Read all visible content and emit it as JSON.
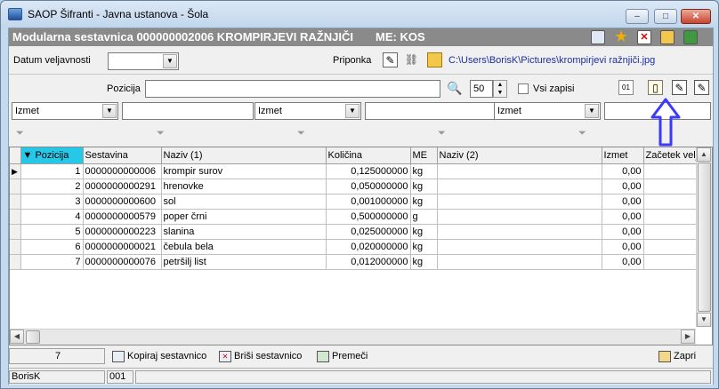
{
  "window": {
    "title": "SAOP Šifranti  - Javna ustanova - Šola",
    "buttons": {
      "minimize": "–",
      "maximize": "□",
      "close": "✕"
    }
  },
  "header": {
    "title": "Modularna sestavnica 000000002006 KROMPIRJEVI RAŽNJIČI",
    "me": "ME: KOS",
    "icons": [
      "list-icon",
      "star-icon",
      "delete-icon",
      "folder-save-icon",
      "export-icon"
    ]
  },
  "form": {
    "datum_label": "Datum veljavnosti",
    "datum_value": "",
    "priponka_label": "Priponka",
    "priponka_path": "C:\\Users\\BorisK\\Pictures\\krompirjevi ražnjiči.jpg",
    "pozicija_label": "Pozicija",
    "pozicija_value": "",
    "count_value": "50",
    "vsi_zapisi_label": "Vsi zapisi",
    "filters": [
      {
        "select": "Izmet",
        "text": ""
      },
      {
        "select": "Izmet",
        "text": ""
      },
      {
        "select": "Izmet",
        "text": ""
      }
    ]
  },
  "grid": {
    "columns": [
      "Pozicija",
      "Sestavina",
      "Naziv (1)",
      "Količina",
      "ME",
      "Naziv (2)",
      "Izmet",
      "Začetek velj"
    ],
    "rows": [
      {
        "pozicija": "1",
        "sestavina": "0000000000006",
        "naziv1": "krompir surov",
        "kolicina": "0,125000000",
        "me": "kg",
        "naziv2": "",
        "izmet": "0,00",
        "zacetek": ""
      },
      {
        "pozicija": "2",
        "sestavina": "0000000000291",
        "naziv1": "hrenovke",
        "kolicina": "0,050000000",
        "me": "kg",
        "naziv2": "",
        "izmet": "0,00",
        "zacetek": ""
      },
      {
        "pozicija": "3",
        "sestavina": "0000000000600",
        "naziv1": "sol",
        "kolicina": "0,001000000",
        "me": "kg",
        "naziv2": "",
        "izmet": "0,00",
        "zacetek": ""
      },
      {
        "pozicija": "4",
        "sestavina": "0000000000579",
        "naziv1": "poper črni",
        "kolicina": "0,500000000",
        "me": "g",
        "naziv2": "",
        "izmet": "0,00",
        "zacetek": ""
      },
      {
        "pozicija": "5",
        "sestavina": "0000000000223",
        "naziv1": "slanina",
        "kolicina": "0,025000000",
        "me": "kg",
        "naziv2": "",
        "izmet": "0,00",
        "zacetek": ""
      },
      {
        "pozicija": "6",
        "sestavina": "0000000000021",
        "naziv1": "čebula bela",
        "kolicina": "0,020000000",
        "me": "kg",
        "naziv2": "",
        "izmet": "0,00",
        "zacetek": ""
      },
      {
        "pozicija": "7",
        "sestavina": "0000000000076",
        "naziv1": "petršilj list",
        "kolicina": "0,012000000",
        "me": "kg",
        "naziv2": "",
        "izmet": "0,00",
        "zacetek": ""
      }
    ]
  },
  "footer": {
    "count": "7",
    "kopiraj": "Kopiraj sestavnico",
    "brisi": "Briši sestavnico",
    "premeci": "Premeči",
    "zapri": "Zapri"
  },
  "status": {
    "user": "BorisK",
    "code": "001"
  },
  "colors": {
    "header_bar": "#8a8a8a",
    "sort_column": "#26c8e8",
    "link": "#1a2fa0",
    "arrow": "#3a3aff"
  }
}
